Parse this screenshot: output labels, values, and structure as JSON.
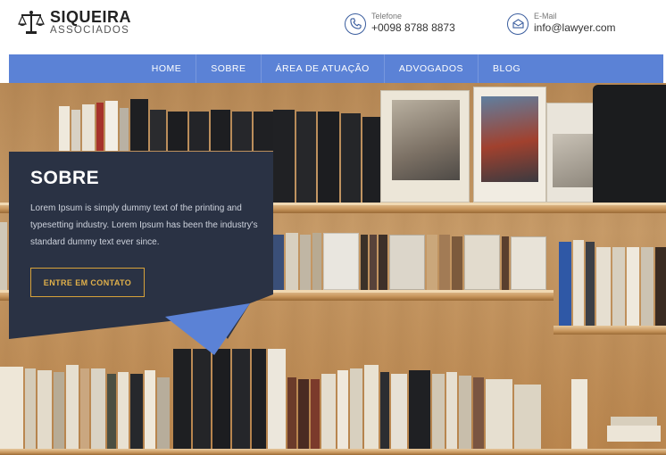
{
  "brand": {
    "name": "SIQUEIRA",
    "sub": "ASSOCIADOS",
    "icon": "scales-of-justice-icon"
  },
  "contacts": {
    "phone": {
      "label": "Telefone",
      "value": "+0098 8788 8873",
      "icon": "phone-icon"
    },
    "email": {
      "label": "E-Mail",
      "value": "info@lawyer.com",
      "icon": "mail-icon"
    }
  },
  "nav": {
    "items": [
      {
        "label": "HOME"
      },
      {
        "label": "SOBRE"
      },
      {
        "label": "ÁREA DE ATUAÇÃO"
      },
      {
        "label": "ADVOGADOS"
      },
      {
        "label": "BLOG"
      }
    ]
  },
  "hero": {
    "title": "SOBRE",
    "text": "Lorem Ipsum is simply dummy text of the printing and typesetting industry. Lorem Ipsum has been the industry's standard dummy text ever since.",
    "button": "ENTRE EM CONTATO"
  },
  "colors": {
    "nav": "#5b82d6",
    "card": "#2a3244",
    "button_border": "#d7a23a"
  }
}
